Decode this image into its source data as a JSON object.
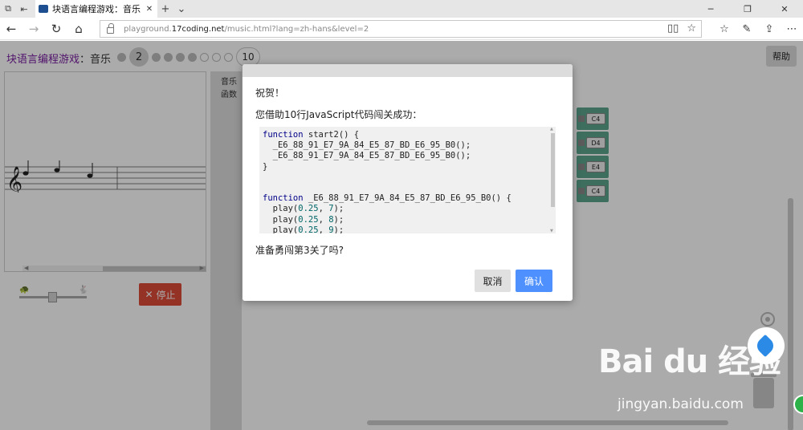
{
  "browser": {
    "tab_title": "块语言编程游戏：音乐",
    "url_prefix": "playground.",
    "url_domain": "17coding.net",
    "url_path": "/music.html?lang=zh-hans&level=2"
  },
  "header": {
    "app_name": "块语言编程游戏",
    "separator": "：",
    "subtitle": "音乐",
    "current_level": "2",
    "last_level": "10",
    "help_label": "帮助"
  },
  "controls": {
    "stop_label": "停止"
  },
  "toolbox": {
    "categories": [
      "音乐",
      "函数"
    ]
  },
  "blocks": [
    "C4",
    "D4",
    "E4",
    "C4"
  ],
  "dialog": {
    "title": "祝贺！",
    "message": "您借助10行JavaScript代码闯关成功：",
    "code_lines": [
      {
        "parts": [
          {
            "t": "kw",
            "v": "function"
          },
          {
            "t": "p",
            "v": " start2() {"
          }
        ]
      },
      {
        "parts": [
          {
            "t": "p",
            "v": "  _E6_88_91_E7_9A_84_E5_87_BD_E6_95_B0();"
          }
        ]
      },
      {
        "parts": [
          {
            "t": "p",
            "v": "  _E6_88_91_E7_9A_84_E5_87_BD_E6_95_B0();"
          }
        ]
      },
      {
        "parts": [
          {
            "t": "p",
            "v": "}"
          }
        ]
      },
      {
        "parts": [
          {
            "t": "p",
            "v": ""
          }
        ]
      },
      {
        "parts": [
          {
            "t": "p",
            "v": ""
          }
        ]
      },
      {
        "parts": [
          {
            "t": "kw",
            "v": "function"
          },
          {
            "t": "p",
            "v": " _E6_88_91_E7_9A_84_E5_87_BD_E6_95_B0() {"
          }
        ]
      },
      {
        "parts": [
          {
            "t": "p",
            "v": "  play("
          },
          {
            "t": "num",
            "v": "0.25"
          },
          {
            "t": "p",
            "v": ", "
          },
          {
            "t": "num",
            "v": "7"
          },
          {
            "t": "p",
            "v": ");"
          }
        ]
      },
      {
        "parts": [
          {
            "t": "p",
            "v": "  play("
          },
          {
            "t": "num",
            "v": "0.25"
          },
          {
            "t": "p",
            "v": ", "
          },
          {
            "t": "num",
            "v": "8"
          },
          {
            "t": "p",
            "v": ");"
          }
        ]
      },
      {
        "parts": [
          {
            "t": "p",
            "v": "  play("
          },
          {
            "t": "num",
            "v": "0.25"
          },
          {
            "t": "p",
            "v": ", "
          },
          {
            "t": "num",
            "v": "9"
          },
          {
            "t": "p",
            "v": ");"
          }
        ]
      }
    ],
    "question": "准备勇闯第3关了吗?",
    "cancel_label": "取消",
    "ok_label": "确认"
  },
  "watermark": {
    "logo": "Bai du 经验",
    "sub": "jingyan.baidu.com"
  }
}
